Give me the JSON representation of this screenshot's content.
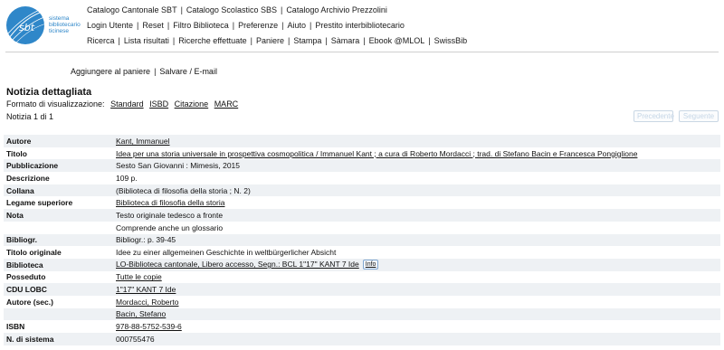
{
  "logo": {
    "lines": [
      "sistema",
      "bibliotecario",
      "ticinese"
    ]
  },
  "nav": {
    "row1": [
      "Catalogo Cantonale SBT",
      "Catalogo Scolastico SBS",
      "Catalogo Archivio Prezzolini"
    ],
    "row2": [
      "Login Utente",
      "Reset",
      "Filtro Biblioteca",
      "Preferenze",
      "Aiuto",
      "Prestito interbibliotecario"
    ],
    "row3": [
      "Ricerca",
      "Lista risultati",
      "Ricerche effettuate",
      "Paniere",
      "Stampa",
      "Sàmara",
      "Ebook @MLOL",
      "SwissBib"
    ]
  },
  "actions": {
    "add": "Aggiungere al paniere",
    "save": "Salvare / E-mail"
  },
  "record": {
    "title": "Notizia dettagliata",
    "format_label": "Formato di visualizzazione:",
    "formats": [
      "Standard",
      "ISBD",
      "Citazione",
      "MARC"
    ],
    "count": "Notizia 1 di 1",
    "prev": "Precedente",
    "next": "Seguente",
    "info_label": "Info",
    "rows": [
      {
        "label": "Autore",
        "value": "Kant, Immanuel",
        "link": true
      },
      {
        "label": "Titolo",
        "value": "Idea per una storia universale in prospettiva cosmopolitica / Immanuel Kant ; a cura di Roberto Mordacci ; trad. di Stefano Bacin e Francesca Pongiglione",
        "link": true
      },
      {
        "label": "Pubblicazione",
        "value": "Sesto San Giovanni : Mimesis, 2015",
        "link": false
      },
      {
        "label": "Descrizione",
        "value": "109 p.",
        "link": false
      },
      {
        "label": "Collana",
        "value": "(Biblioteca di filosofia della storia ; N. 2)",
        "link": false
      },
      {
        "label": "Legame superiore",
        "value": "Biblioteca di filosofia della storia",
        "link": true
      },
      {
        "label": "Nota",
        "value": "Testo originale tedesco a fronte",
        "link": false
      },
      {
        "label": "",
        "value": "Comprende anche un glossario",
        "link": false
      },
      {
        "label": "Bibliogr.",
        "value": "Bibliogr.: p. 39-45",
        "link": false
      },
      {
        "label": "Titolo originale",
        "value": "Idee zu einer allgemeinen Geschichte in weltbürgerlicher Absicht",
        "link": false
      },
      {
        "label": "Biblioteca",
        "value": "LO-Biblioteca cantonale, Libero accesso, Segn.: BCL 1\"17\" KANT 7 Ide",
        "link": true,
        "info": true
      },
      {
        "label": "Posseduto",
        "value": "Tutte le copie",
        "link": true
      },
      {
        "label": "CDU LOBC",
        "value": "1\"17\" KANT 7 Ide",
        "link": true
      },
      {
        "label": "Autore (sec.)",
        "value": "Mordacci, Roberto",
        "link": true
      },
      {
        "label": "",
        "value": "Bacin, Stefano",
        "link": true
      },
      {
        "label": "ISBN",
        "value": "978-88-5752-539-6",
        "link": true
      },
      {
        "label": "N. di sistema",
        "value": "000755476",
        "link": false
      }
    ]
  }
}
